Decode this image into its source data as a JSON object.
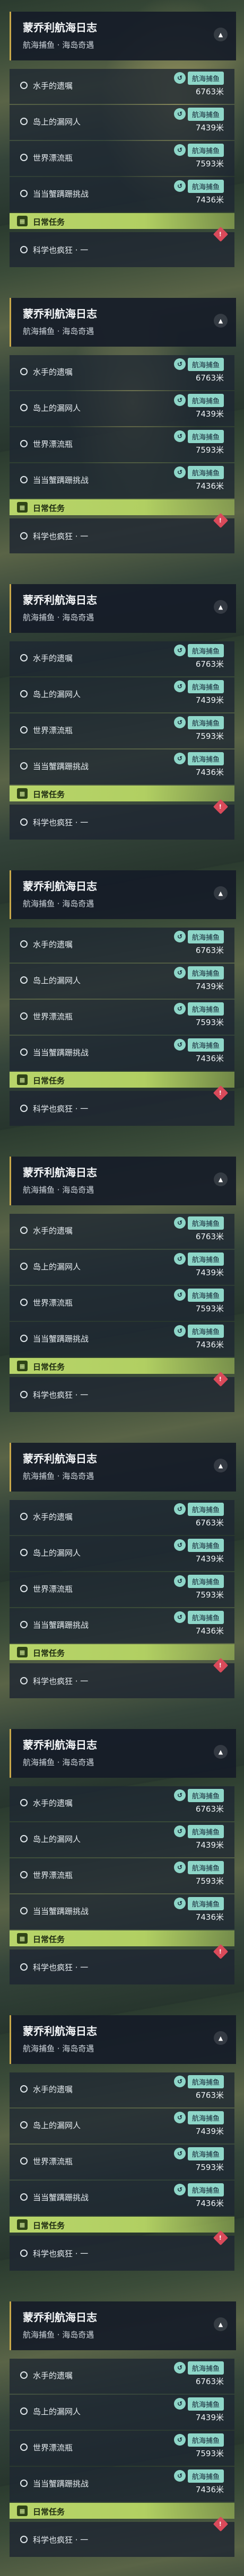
{
  "quest_panel": {
    "title": "蒙乔利航海日志",
    "subtitle": "航海捕鱼 · 海岛奇遇",
    "collapse_icon": "chevron-up-icon",
    "tasks": [
      {
        "label": "水手的遗嘱",
        "tag": "航海捕鱼",
        "distance": "6763米"
      },
      {
        "label": "岛上的漏网人",
        "tag": "航海捕鱼",
        "distance": "7439米"
      },
      {
        "label": "世界漂流瓶",
        "tag": "航海捕鱼",
        "distance": "7593米"
      },
      {
        "label": "当当蟹蹒跚挑战",
        "tag": "航海捕鱼",
        "distance": "7436米"
      }
    ],
    "daily": {
      "header": "日常任务",
      "icon": "calendar-icon",
      "task_label": "科学也疯狂 · 一",
      "alert": "!"
    },
    "accent_color": "#8ed6c8",
    "daily_color": "#b8d56a",
    "repeat_count": 9
  }
}
